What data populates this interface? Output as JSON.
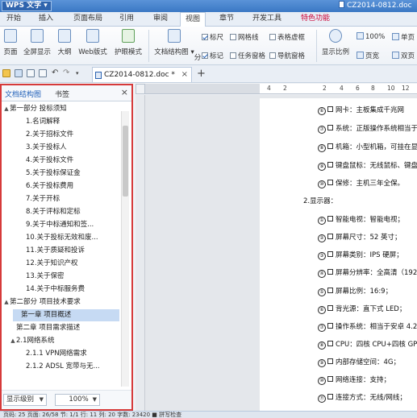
{
  "titlebar": {
    "app_label": "WPS 文字 ▾",
    "doc_title": "CZ2014-0812.doc *"
  },
  "menubar": {
    "items": [
      "开始",
      "插入",
      "页面布局",
      "引用",
      "审阅",
      "视图",
      "章节",
      "开发工具",
      "特色功能"
    ],
    "active": "视图"
  },
  "ribbon": {
    "view_buttons": [
      "页面",
      "全屏显示",
      "大纲",
      "Web版式",
      "护眼模式"
    ],
    "doc_map_label": "文档结构图 ▾",
    "split_label": "分",
    "checkboxes": [
      {
        "label": "标尺",
        "checked": true
      },
      {
        "label": "网格线",
        "checked": false
      },
      {
        "label": "表格虚框",
        "checked": false
      },
      {
        "label": "标记",
        "checked": true
      },
      {
        "label": "任务窗格",
        "checked": false
      },
      {
        "label": "导航窗格",
        "checked": false
      }
    ],
    "zoom_label": "显示比例",
    "zoom_100": "100%",
    "single_page": "单页",
    "page_width": "页宽",
    "double_page": "双页"
  },
  "tabbar": {
    "doc_tab": "CZ2014-0812.doc *",
    "new_tab": "+",
    "close": "×"
  },
  "panel": {
    "tab_docmap": "文档结构图",
    "tab_bookmark": "书签",
    "close": "×",
    "tree": [
      {
        "level": 0,
        "toggle": "▲",
        "text": "第一部分    投标须知"
      },
      {
        "level": 2,
        "text": "1.名词解释"
      },
      {
        "level": 2,
        "text": "2.关于招标文件"
      },
      {
        "level": 2,
        "text": "3.关于投标人"
      },
      {
        "level": 2,
        "text": "4.关于投标文件"
      },
      {
        "level": 2,
        "text": "5.关于投标保证金"
      },
      {
        "level": 2,
        "text": "6.关于投标费用"
      },
      {
        "level": 2,
        "text": "7.关于开标"
      },
      {
        "level": 2,
        "text": "8.关于评标和定标"
      },
      {
        "level": 2,
        "text": "9.关于中标通知和签..."
      },
      {
        "level": 2,
        "text": "10.关于投标无效和废..."
      },
      {
        "level": 2,
        "text": "11.关于质疑和投诉"
      },
      {
        "level": 2,
        "text": "12.关于知识产权"
      },
      {
        "level": 2,
        "text": "13.关于保密"
      },
      {
        "level": 2,
        "text": "14.关于中标服务费"
      },
      {
        "level": 0,
        "toggle": "▲",
        "text": "第二部分    项目技术要求"
      },
      {
        "level": 1,
        "text": "第一章 项目概述",
        "selected": true
      },
      {
        "level": 1,
        "text": "第二章 项目需求描述"
      },
      {
        "level": 1,
        "toggle": "▲",
        "text": "2.1网络系统"
      },
      {
        "level": 2,
        "text": "2.1.1 VPN网络需求"
      },
      {
        "level": 2,
        "text": "2.1.2 ADSL 宽带与无..."
      }
    ],
    "footer": {
      "level_select": "显示级别",
      "zoom_select": "100%"
    }
  },
  "ruler": {
    "numbers": [
      "4",
      "2",
      "2",
      "4",
      "6",
      "8",
      "10",
      "12",
      "14"
    ]
  },
  "document": {
    "lines": [
      {
        "mark": "⑥",
        "box": true,
        "text": "网卡：主板集成千兆网"
      },
      {
        "mark": "⑦",
        "box": true,
        "text": "系统：正版操作系统相当于"
      },
      {
        "mark": "⑧",
        "box": true,
        "text": "机箱：小型机箱，可挂在显"
      },
      {
        "mark": "⑨",
        "box": true,
        "text": "键盘鼠标：无线鼠标、键盘"
      },
      {
        "mark": "⑩",
        "box": true,
        "text": "保修：主机三年全保。"
      },
      {
        "mark": "",
        "box": false,
        "text": "2.显示器："
      },
      {
        "mark": "①",
        "box": true,
        "text": "智能电视：智能电视；"
      },
      {
        "mark": "②",
        "box": true,
        "text": "屏幕尺寸：52 英寸；"
      },
      {
        "mark": "③",
        "box": true,
        "text": "屏幕类别：IPS 硬屏；"
      },
      {
        "mark": "④",
        "box": true,
        "text": "屏幕分辨率：全高清（1920"
      },
      {
        "mark": "⑤",
        "box": true,
        "text": "屏幕比例：16:9；"
      },
      {
        "mark": "⑥",
        "box": true,
        "text": "背光源：直下式 LED；"
      },
      {
        "mark": "⑦",
        "box": true,
        "text": "操作系统：相当于安卓 4.2"
      },
      {
        "mark": "⑧",
        "box": true,
        "text": "CPU：四核 CPU+四核 GPU；"
      },
      {
        "mark": "⑨",
        "box": true,
        "text": "内部存储空间：4G；"
      },
      {
        "mark": "⑩",
        "box": true,
        "text": "网络连接：支持；"
      },
      {
        "mark": "⑪",
        "box": true,
        "text": "连接方式：无线/网线；"
      },
      {
        "mark": "⑫",
        "box": true,
        "text": "支架：立体落地支架一套"
      }
    ]
  },
  "statusbar": {
    "text": "页码: 25   页面: 26/58   节: 1/1   行: 11   列: 20   字数: 23420   ■ 拼写检查"
  },
  "colors": {
    "accent": "#1f5fb8",
    "panel_border": "#d63a3a",
    "selected": "#c6daf3"
  }
}
